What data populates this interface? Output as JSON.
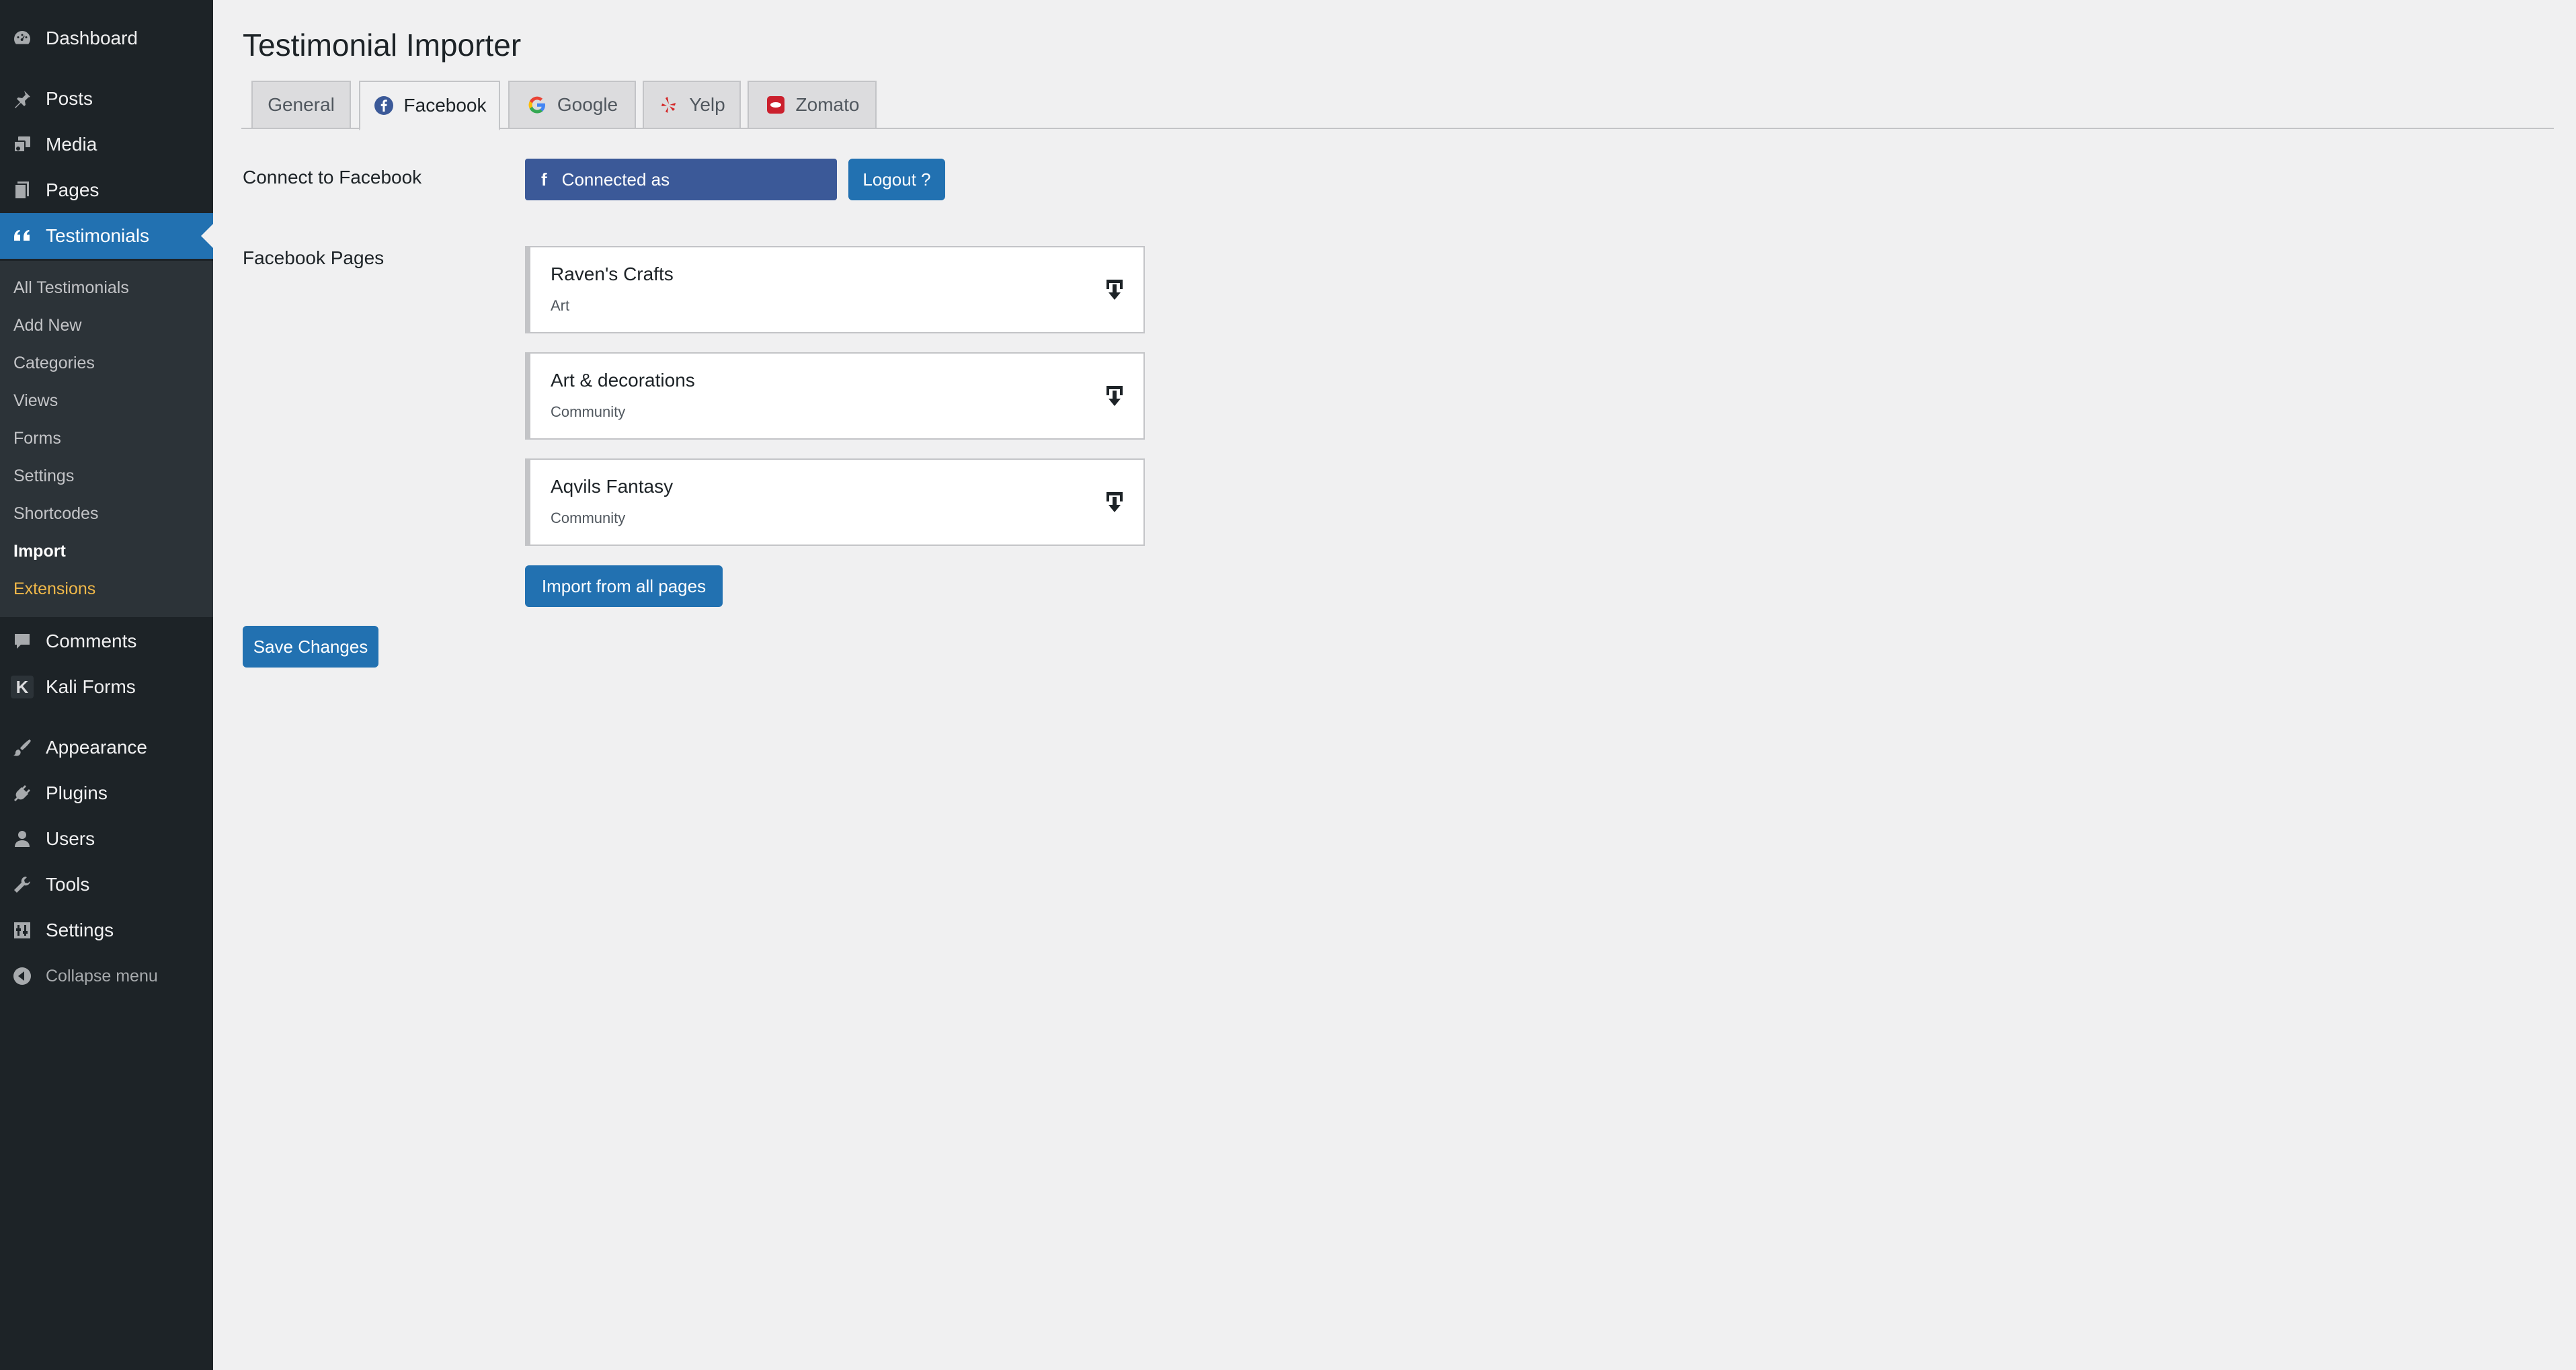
{
  "sidebar": {
    "top_items": [
      {
        "label": "Dashboard",
        "icon": "dashboard-icon"
      },
      {
        "label": "Posts",
        "icon": "pin-icon"
      },
      {
        "label": "Media",
        "icon": "media-icon"
      },
      {
        "label": "Pages",
        "icon": "pages-icon"
      },
      {
        "label": "Testimonials",
        "icon": "quote-icon"
      }
    ],
    "submenu": [
      {
        "label": "All Testimonials"
      },
      {
        "label": "Add New"
      },
      {
        "label": "Categories"
      },
      {
        "label": "Views"
      },
      {
        "label": "Forms"
      },
      {
        "label": "Settings"
      },
      {
        "label": "Shortcodes"
      },
      {
        "label": "Import"
      },
      {
        "label": "Extensions"
      }
    ],
    "bottom_items": [
      {
        "label": "Comments",
        "icon": "comment-icon"
      },
      {
        "label": "Kali Forms",
        "icon": "kali-forms-icon",
        "glyph": "K"
      },
      {
        "label": "Appearance",
        "icon": "brush-icon"
      },
      {
        "label": "Plugins",
        "icon": "plugin-icon"
      },
      {
        "label": "Users",
        "icon": "user-icon"
      },
      {
        "label": "Tools",
        "icon": "wrench-icon"
      },
      {
        "label": "Settings",
        "icon": "settings-icon"
      },
      {
        "label": "Collapse menu",
        "icon": "collapse-icon"
      }
    ],
    "active_color": "#2271b1",
    "extensions_color": "#f0b849"
  },
  "main": {
    "title": "Testimonial Importer",
    "tabs": [
      {
        "label": "General",
        "icon": ""
      },
      {
        "label": "Facebook",
        "icon": "facebook-icon"
      },
      {
        "label": "Google",
        "icon": "google-icon"
      },
      {
        "label": "Yelp",
        "icon": "yelp-icon"
      },
      {
        "label": "Zomato",
        "icon": "zomato-icon"
      }
    ],
    "active_tab": "Facebook",
    "connect_label": "Connect to Facebook",
    "connected_button": "Connected as",
    "facebook_glyph": "f",
    "logout_button": "Logout ?",
    "pages_label": "Facebook Pages",
    "pages": [
      {
        "name": "Raven's Crafts",
        "category": "Art"
      },
      {
        "name": "Art & decorations",
        "category": "Community"
      },
      {
        "name": "Aqvils Fantasy",
        "category": "Community"
      }
    ],
    "import_all_button": "Import from all pages",
    "save_button": "Save Changes",
    "facebook_color": "#3b5998"
  }
}
